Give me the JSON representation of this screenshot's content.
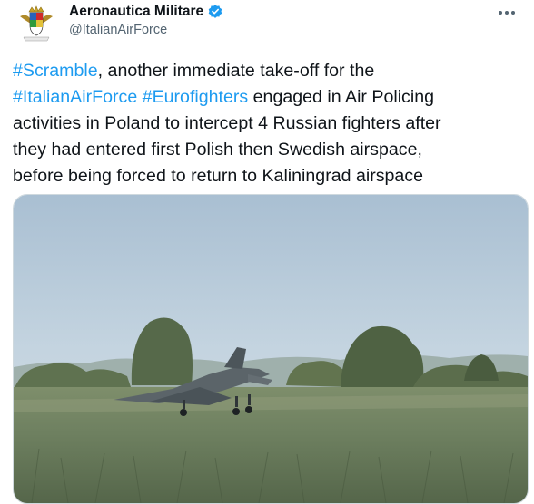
{
  "author": {
    "display_name": "Aeronautica Militare",
    "handle": "@ItalianAirForce",
    "verified": true,
    "avatar_icon": "crest-icon",
    "more_icon": "more-icon"
  },
  "tweet": {
    "line1_link": "#Scramble",
    "line1_rest": ", another immediate take-off for the",
    "line2_link1": "#ItalianAirForce",
    "line2_space": " ",
    "line2_link2": "#Eurofighters",
    "line2_rest": " engaged in Air Policing",
    "line3": "activities in Poland to intercept 4 Russian fighters after",
    "line4": "they had entered first Polish then Swedish airspace,",
    "line5": "before being forced to return to Kaliningrad airspace"
  },
  "colors": {
    "link": "#1d9bf0",
    "text": "#0f1419",
    "secondary": "#536471",
    "verified": "#1d9bf0"
  }
}
